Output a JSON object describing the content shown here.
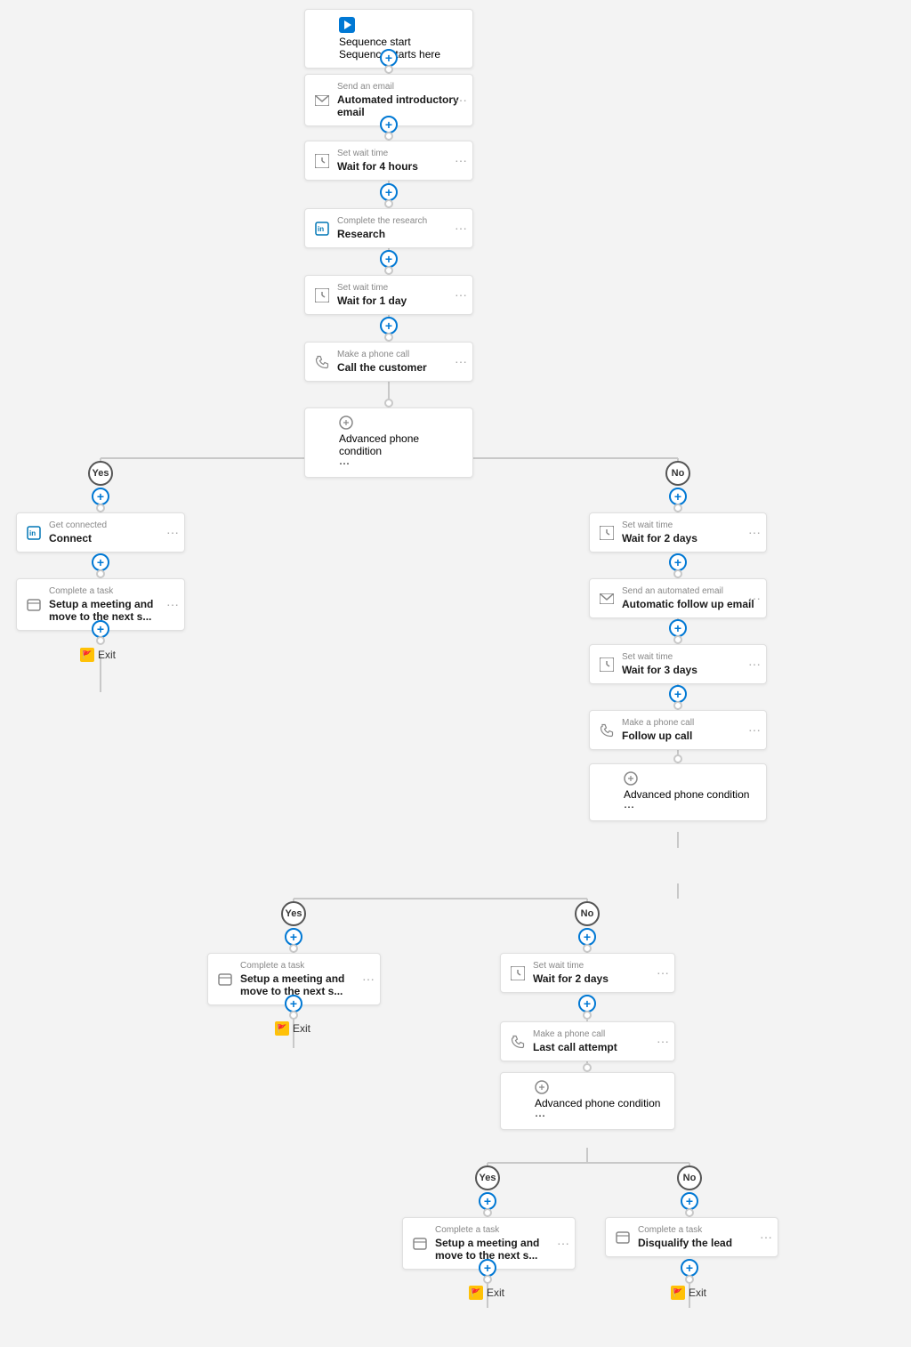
{
  "nodes": {
    "sequence_start": {
      "type_label": "Sequence start",
      "label": "Sequence starts here"
    },
    "send_email_1": {
      "type_label": "Send an email",
      "label": "Automated introductory email"
    },
    "wait_1": {
      "type_label": "Set wait time",
      "label": "Wait for 4 hours"
    },
    "research": {
      "type_label": "Complete the research",
      "label": "Research"
    },
    "wait_2": {
      "type_label": "Set wait time",
      "label": "Wait for 1 day"
    },
    "phone_call_1": {
      "type_label": "Make a phone call",
      "label": "Call the customer"
    },
    "condition_1": {
      "label": "Advanced phone condition"
    },
    "yes_label_1": "Yes",
    "no_label_1": "No",
    "connect": {
      "type_label": "Get connected",
      "label": "Connect"
    },
    "setup_meeting_1": {
      "type_label": "Complete a task",
      "label": "Setup a meeting and move to the next s..."
    },
    "exit_1": "Exit",
    "wait_no_1": {
      "type_label": "Set wait time",
      "label": "Wait for 2 days"
    },
    "auto_followup": {
      "type_label": "Send an automated email",
      "label": "Automatic follow up email"
    },
    "wait_3": {
      "type_label": "Set wait time",
      "label": "Wait for 3 days"
    },
    "followup_call": {
      "type_label": "Make a phone call",
      "label": "Follow up call"
    },
    "condition_2": {
      "label": "Advanced phone condition"
    },
    "yes_label_2": "Yes",
    "no_label_2": "No",
    "setup_meeting_2": {
      "type_label": "Complete a task",
      "label": "Setup a meeting and move to the next s..."
    },
    "exit_2": "Exit",
    "wait_no_2": {
      "type_label": "Set wait time",
      "label": "Wait for 2 days"
    },
    "last_call": {
      "type_label": "Make a phone call",
      "label": "Last call attempt"
    },
    "condition_3": {
      "label": "Advanced phone condition"
    },
    "yes_label_3": "Yes",
    "no_label_3": "No",
    "setup_meeting_3": {
      "type_label": "Complete a task",
      "label": "Setup a meeting and move to the next s..."
    },
    "disqualify": {
      "type_label": "Complete a task",
      "label": "Disqualify the lead"
    },
    "exit_3": "Exit",
    "exit_4": "Exit"
  }
}
